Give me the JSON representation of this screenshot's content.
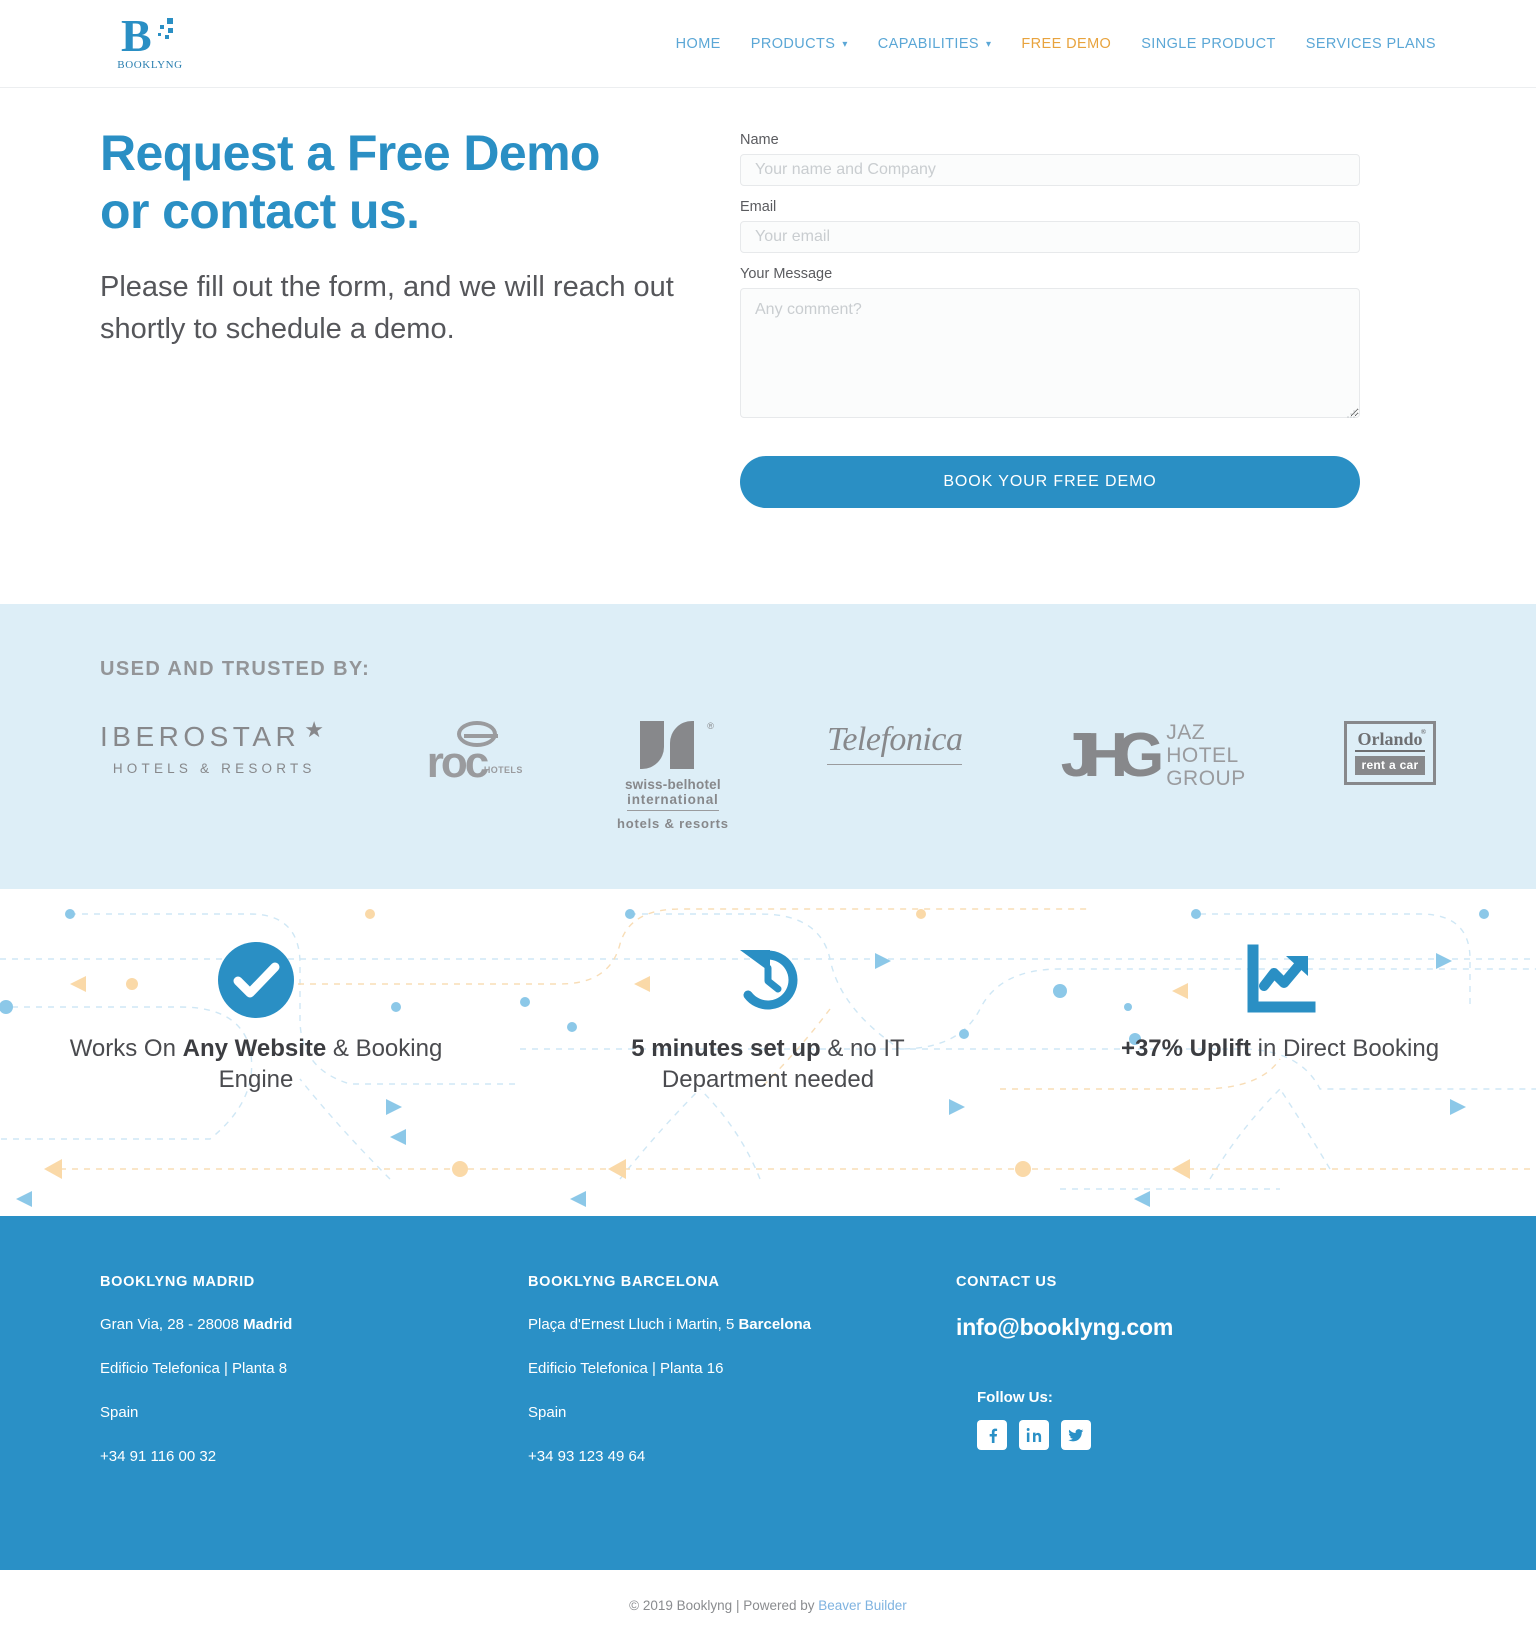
{
  "brand": {
    "logo_letter": "B",
    "logo_name": "BOOKLYNG"
  },
  "nav": {
    "items": [
      {
        "label": "HOME",
        "has_caret": false,
        "active": false
      },
      {
        "label": "PRODUCTS",
        "has_caret": true,
        "active": false
      },
      {
        "label": "CAPABILITIES",
        "has_caret": true,
        "active": false
      },
      {
        "label": "FREE DEMO",
        "has_caret": false,
        "active": true
      },
      {
        "label": "SINGLE PRODUCT",
        "has_caret": false,
        "active": false
      },
      {
        "label": "SERVICES PLANS",
        "has_caret": false,
        "active": false
      }
    ],
    "caret_glyph": "⌄"
  },
  "hero": {
    "title_line1": "Request a Free Demo",
    "title_line2": "or contact us.",
    "subtitle": "Please fill out the form, and we will reach out shortly to schedule a demo."
  },
  "form": {
    "name_label": "Name",
    "name_placeholder": "Your name and Company",
    "name_value": "",
    "email_label": "Email",
    "email_placeholder": "Your email",
    "email_value": "",
    "message_label": "Your Message",
    "message_placeholder": "Any comment?",
    "message_value": "",
    "submit_label": "BOOK YOUR FREE DEMO"
  },
  "trusted": {
    "title": "USED AND TRUSTED BY:",
    "background_color": "#ddeef7",
    "logos": [
      {
        "name": "IBEROSTAR",
        "sub": "HOTELS & RESORTS",
        "star": "★"
      },
      {
        "name": "roc",
        "sub": "HOTELS"
      },
      {
        "name": "swiss-belhotel",
        "line2": "international",
        "line3": "hotels & resorts",
        "reg": "®"
      },
      {
        "name": "Telefonica"
      },
      {
        "name": "JHG",
        "words_line1": "JAZ",
        "words_line2": "HOTEL",
        "words_line3": "GROUP"
      },
      {
        "name": "Orlando",
        "sub": "rent a car",
        "reg": "®"
      }
    ]
  },
  "features": [
    {
      "icon": "check-circle-icon",
      "text_pre": "Works On ",
      "text_bold": "Any Website",
      "text_post": " & Booking Engine"
    },
    {
      "icon": "clock-rewind-icon",
      "text_pre": "",
      "text_bold": "5 minutes set up",
      "text_post": " & no IT Department needed"
    },
    {
      "icon": "chart-uptrend-icon",
      "text_pre": "",
      "text_bold": "+37% Uplift",
      "text_post": " in Direct Booking"
    }
  ],
  "footer": {
    "background_color": "#2a90c6",
    "madrid": {
      "heading": "BOOKLYNG MADRID",
      "line1_pre": "Gran Via, 28 - 28008 ",
      "line1_bold": "Madrid",
      "line2": "Edificio Telefonica | Planta 8",
      "line3": "Spain",
      "line4": "+34 91 116 00 32"
    },
    "barcelona": {
      "heading": "BOOKLYNG  BARCELONA",
      "line1_pre": "Plaça d'Ernest Lluch i Martin, 5 ",
      "line1_bold": "Barcelona",
      "line2": "Edificio Telefonica | Planta 16",
      "line3": "Spain",
      "line4": "+34 93 123 49 64"
    },
    "contact": {
      "heading": "CONTACT US",
      "email": "info@booklyng.com",
      "follow_label": "Follow Us:",
      "social": [
        {
          "name": "facebook-icon"
        },
        {
          "name": "linkedin-icon"
        },
        {
          "name": "twitter-icon"
        }
      ]
    }
  },
  "copyright": {
    "text": "© 2019 Booklyng | Powered by ",
    "link": "Beaver Builder"
  },
  "colors": {
    "brand_blue": "#2a8fc4",
    "nav_blue": "#5ba7d6",
    "accent_orange": "#e8a33d",
    "band_blue": "#ddeef7",
    "footer_blue": "#2a90c6"
  }
}
